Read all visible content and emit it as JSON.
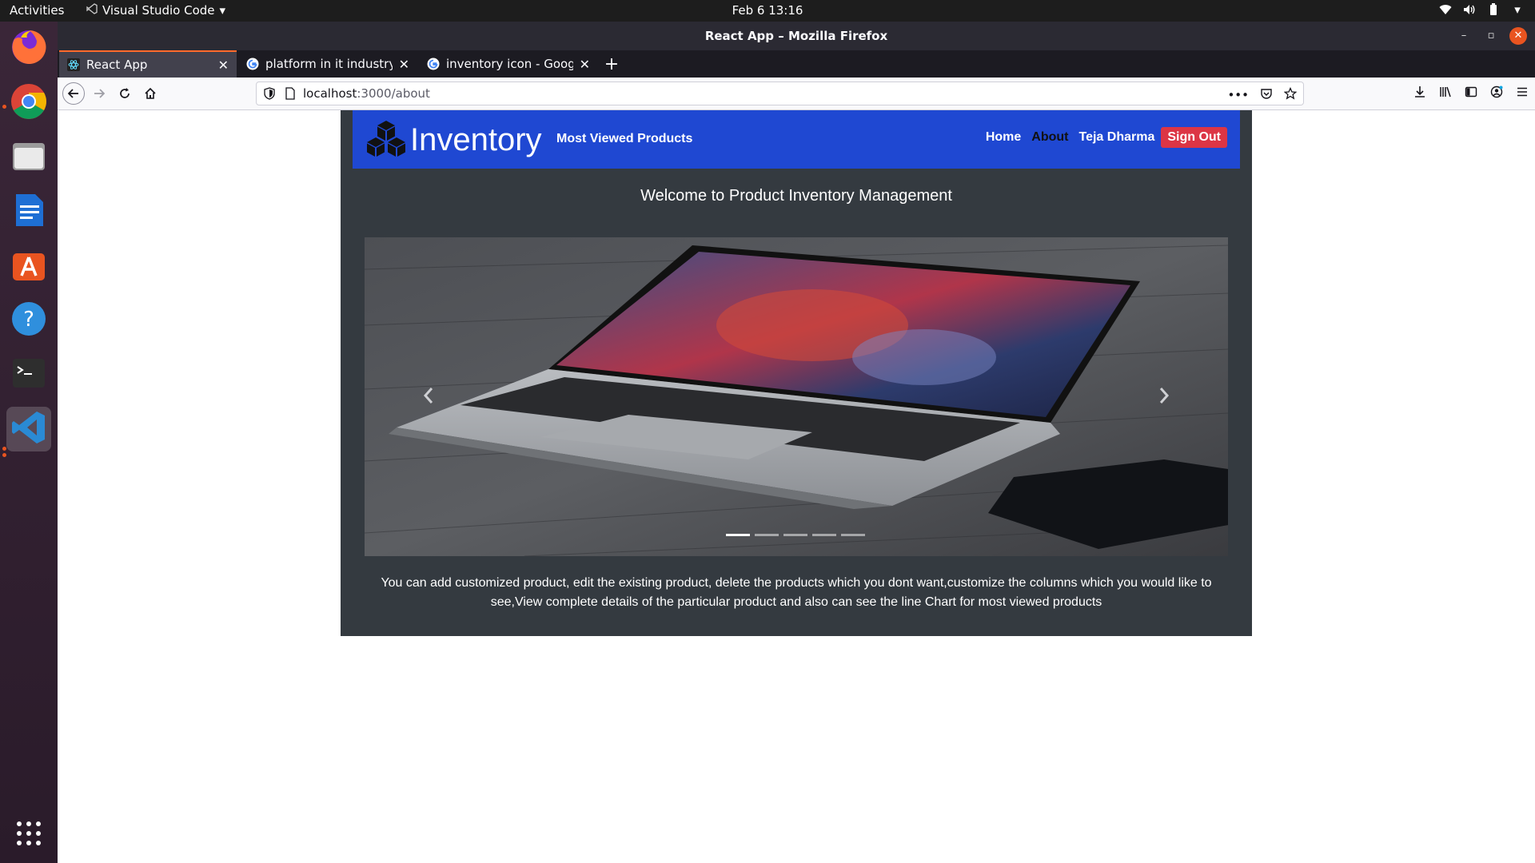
{
  "topbar": {
    "activities": "Activities",
    "app_name": "Visual Studio Code",
    "clock": "Feb 6  13:16"
  },
  "dock": {
    "items": [
      "firefox-icon",
      "chrome-icon",
      "files-icon",
      "writer-icon",
      "software-icon",
      "help-icon",
      "terminal-icon",
      "vscode-icon",
      "app-grid-icon"
    ]
  },
  "window": {
    "title": "React App – Mozilla Firefox"
  },
  "tabs": [
    {
      "title": "React App"
    },
    {
      "title": "platform in it industry - G"
    },
    {
      "title": "inventory icon - Google S"
    }
  ],
  "urlbar": {
    "host": "localhost",
    "path": ":3000/about"
  },
  "app": {
    "brand": "Inventory",
    "nav_most_viewed": "Most Viewed Products",
    "nav_home": "Home",
    "nav_about": "About",
    "nav_user": "Teja Dharma",
    "nav_signout": "Sign Out",
    "welcome": "Welcome to Product Inventory Management",
    "carousel": {
      "slide_count": 5,
      "active_index": 0
    },
    "description": "You can add customized product, edit the existing product, delete the products which you dont want,customize the columns which you would like to see,View complete details of the particular product and also can see the line Chart for most viewed products"
  },
  "colors": {
    "app_navbar": "#1f48d2",
    "container": "#343a40",
    "signout": "#dc3545",
    "tab_accent": "#ff6a2b"
  }
}
